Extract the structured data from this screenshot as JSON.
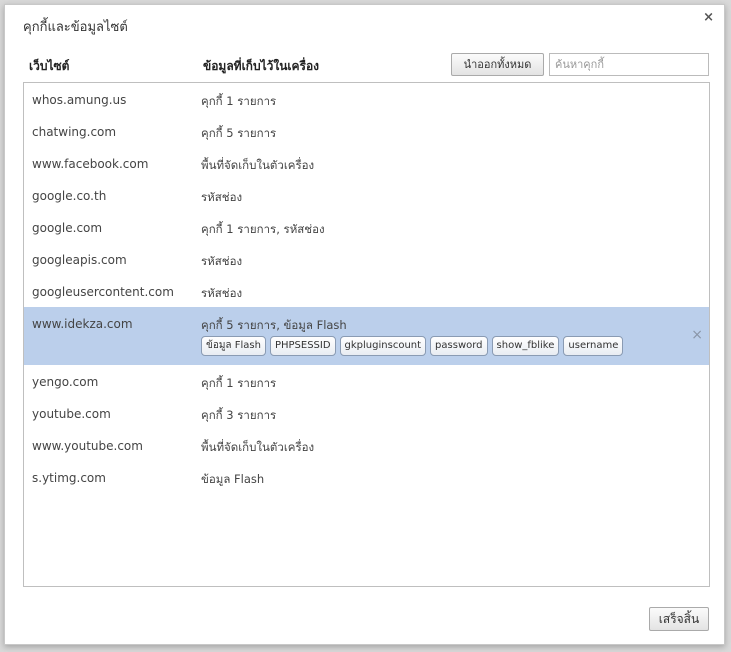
{
  "dialog": {
    "title": "คุกกี้และข้อมูลไซต์",
    "close_icon": "×"
  },
  "header": {
    "site_col": "เว็บไซต์",
    "data_col": "ข้อมูลที่เก็บไว้ในเครื่อง",
    "remove_all_label": "นำออกทั้งหมด",
    "search_placeholder": "ค้นหาคุกกี้"
  },
  "rows": [
    {
      "site": "whos.amung.us",
      "data": "คุกกี้ 1 รายการ"
    },
    {
      "site": "chatwing.com",
      "data": "คุกกี้ 5 รายการ"
    },
    {
      "site": "www.facebook.com",
      "data": "พื้นที่จัดเก็บในตัวเครื่อง"
    },
    {
      "site": "google.co.th",
      "data": "รหัสช่อง"
    },
    {
      "site": "google.com",
      "data": "คุกกี้ 1 รายการ, รหัสช่อง"
    },
    {
      "site": "googleapis.com",
      "data": "รหัสช่อง"
    },
    {
      "site": "googleusercontent.com",
      "data": "รหัสช่อง"
    }
  ],
  "selected_row": {
    "site": "www.idekza.com",
    "data": "คุกกี้ 5 รายการ, ข้อมูล Flash",
    "chips": [
      "ข้อมูล Flash",
      "PHPSESSID",
      "gkpluginscount",
      "password",
      "show_fblike",
      "username"
    ],
    "remove_icon": "×"
  },
  "rows_after": [
    {
      "site": "yengo.com",
      "data": "คุกกี้ 1 รายการ"
    },
    {
      "site": "youtube.com",
      "data": "คุกกี้ 3 รายการ"
    },
    {
      "site": "www.youtube.com",
      "data": "พื้นที่จัดเก็บในตัวเครื่อง"
    },
    {
      "site": "s.ytimg.com",
      "data": "ข้อมูล Flash"
    }
  ],
  "footer": {
    "done_label": "เสร็จสิ้น"
  },
  "colors": {
    "selected_row_bg": "#bbcfeb",
    "dialog_bg": "#ffffff"
  }
}
